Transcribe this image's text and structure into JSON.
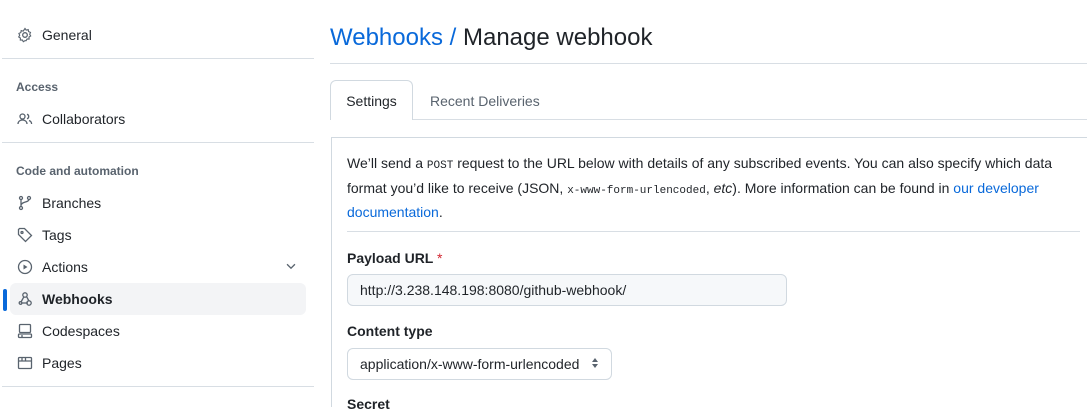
{
  "sidebar": {
    "general": "General",
    "access_heading": "Access",
    "collaborators": "Collaborators",
    "code_heading": "Code and automation",
    "items": [
      {
        "label": "Branches",
        "icon": "git-branch-icon"
      },
      {
        "label": "Tags",
        "icon": "tag-icon"
      },
      {
        "label": "Actions",
        "icon": "play-icon"
      },
      {
        "label": "Webhooks",
        "icon": "webhook-icon",
        "active": true
      },
      {
        "label": "Codespaces",
        "icon": "codespaces-icon"
      },
      {
        "label": "Pages",
        "icon": "browser-icon"
      }
    ],
    "accent": "#0969da"
  },
  "header": {
    "breadcrumb_link": "Webhooks",
    "separator": "/",
    "title": "Manage webhook"
  },
  "tabs": [
    {
      "label": "Settings",
      "active": true
    },
    {
      "label": "Recent Deliveries"
    }
  ],
  "intro": {
    "t1": "We’ll send a ",
    "code1": "POST",
    "t2": " request to the URL below with details of any subscribed events. You can also specify which data format you’d like to receive (JSON, ",
    "code2": "x-www-form-urlencoded",
    "t3": ", ",
    "etc": "etc",
    "t4": "). More information can be found in ",
    "link": "our developer documentation",
    "t5": "."
  },
  "form": {
    "payload_label": "Payload URL",
    "required_mark": "*",
    "payload_value": "http://3.238.148.198:8080/github-webhook/",
    "content_type_label": "Content type",
    "content_type_value": "application/x-www-form-urlencoded",
    "secret_label": "Secret"
  }
}
